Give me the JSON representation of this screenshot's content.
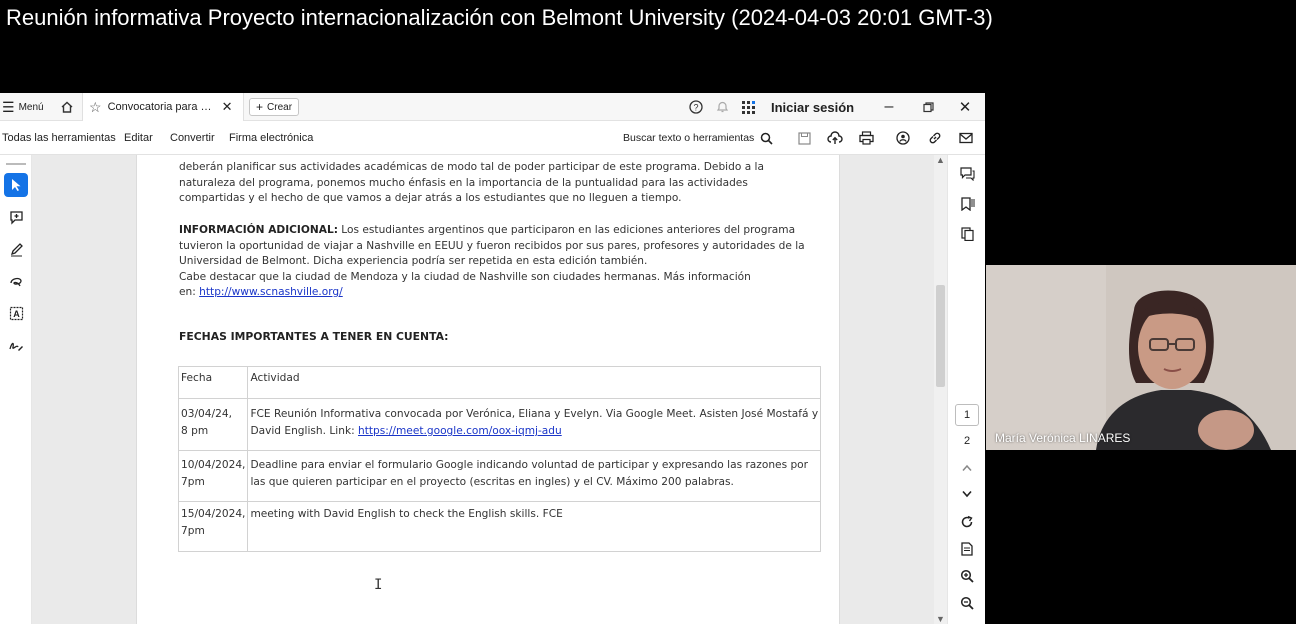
{
  "meeting": {
    "title": "Reunión informativa Proyecto internacionalización con Belmont University (2024-04-03 20:01 GMT-3)"
  },
  "tabbar": {
    "menu_label": "Menú",
    "tab_title": "Convocatoria para pa...",
    "create_label": "Crear",
    "signin_label": "Iniciar sesión"
  },
  "toolbar": {
    "all_tools": "Todas las herramientas",
    "edit": "Editar",
    "convert": "Convertir",
    "e_signature": "Firma electrónica",
    "search_label": "Buscar texto o herramientas"
  },
  "document": {
    "para1_lines": [
      "deberán planificar sus actividades académicas de modo tal de poder participar de este programa. Debido a la",
      "naturaleza del programa, ponemos mucho énfasis en la importancia de la puntualidad para las actividades",
      "compartidas y el hecho de que vamos a dejar atrás a los estudiantes que no lleguen a tiempo."
    ],
    "info_heading": "INFORMACIÓN ADICIONAL:",
    "info_line1": " Los estudiantes argentinos que participaron en las ediciones anteriores del programa",
    "info_lines": [
      "tuvieron la oportunidad de viajar a Nashville en EEUU y fueron recibidos por sus pares, profesores y autoridades de la",
      "Universidad de Belmont. Dicha experiencia podría ser repetida en esta edición también.",
      "Cabe destacar que la ciudad de Mendoza y la ciudad de Nashville son ciudades hermanas. Más información"
    ],
    "info_link_prefix": "en: ",
    "info_link": "http://www.scnashville.org/",
    "dates_heading": "FECHAS IMPORTANTES A TENER EN CUENTA:",
    "table": {
      "headers": [
        "Fecha",
        "Actividad"
      ],
      "rows": [
        {
          "date_l1": "03/04/24,",
          "date_l2": "8 pm",
          "activity_l1": " FCE Reunión Informativa convocada por Verónica, Eliana y Evelyn. Via Google Meet. Asisten José Mostafá y",
          "activity_l2": "David English. Link: ",
          "activity_link": "https://meet.google.com/oox-iqmj-adu"
        },
        {
          "date_l1": "10/04/2024,",
          "date_l2": "7pm",
          "activity_l1": "Deadline para enviar el formulario Google indicando voluntad de participar y expresando las razones por",
          "activity_l2": "las que quieren participar en el proyecto (escritas en ingles) y el CV. Máximo 200 palabras."
        },
        {
          "date_l1": "15/04/2024,",
          "date_l2": "7pm",
          "activity_l1": "meeting with David English to check the English skills. FCE",
          "activity_l2": ""
        }
      ]
    }
  },
  "page_nav": {
    "page1": "1",
    "page2": "2"
  },
  "participant": {
    "name": "María Verónica LINARES"
  },
  "colors": {
    "accent": "#1473e6",
    "link": "#1a35c8"
  }
}
